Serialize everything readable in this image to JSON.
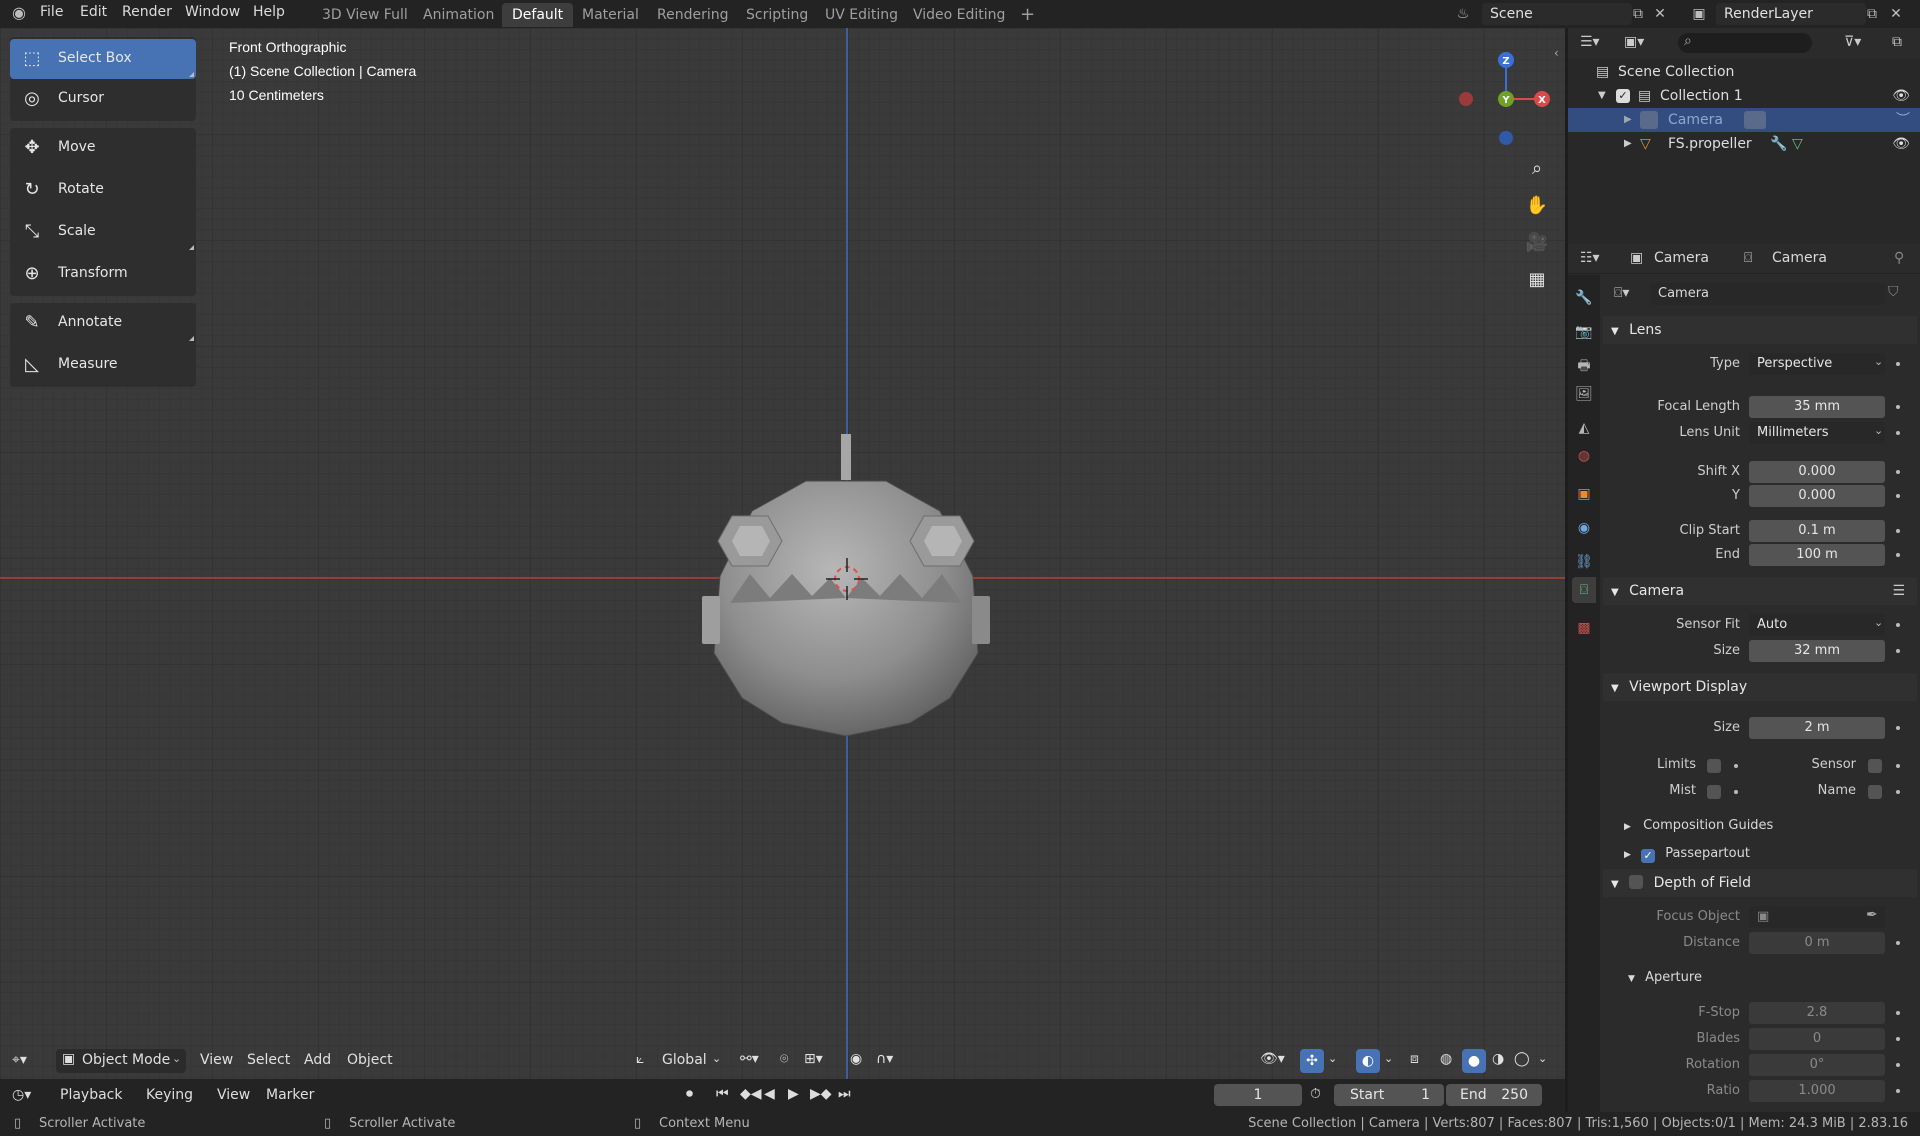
{
  "topbar": {
    "menus": [
      "File",
      "Edit",
      "Render",
      "Window",
      "Help"
    ],
    "workspaces": [
      "3D View Full",
      "Animation",
      "Default",
      "Material",
      "Rendering",
      "Scripting",
      "UV Editing",
      "Video Editing"
    ],
    "active_workspace": "Default",
    "add_tab": "+",
    "scene": "Scene",
    "render_layer": "RenderLayer"
  },
  "toolbar": {
    "tools": [
      {
        "label": "Select Box",
        "icon": "select-box-icon",
        "glyph": "⬚"
      },
      {
        "label": "Cursor",
        "icon": "cursor-icon",
        "glyph": "◎"
      },
      {
        "label": "Move",
        "icon": "move-icon",
        "glyph": "✥"
      },
      {
        "label": "Rotate",
        "icon": "rotate-icon",
        "glyph": "↻"
      },
      {
        "label": "Scale",
        "icon": "scale-icon",
        "glyph": "⤡"
      },
      {
        "label": "Transform",
        "icon": "transform-icon",
        "glyph": "⊕"
      },
      {
        "label": "Annotate",
        "icon": "annotate-icon",
        "glyph": "✎"
      },
      {
        "label": "Measure",
        "icon": "measure-icon",
        "glyph": "📐"
      }
    ],
    "active_tool": "Select Box"
  },
  "viewport": {
    "view_name": "Front Orthographic",
    "collection_info": "(1) Scene Collection | Camera",
    "scale_info": "10 Centimeters",
    "gizmo": {
      "z": "Z",
      "y": "Y",
      "x": "X"
    },
    "header": {
      "mode": "Object Mode",
      "menus": [
        "View",
        "Select",
        "Add",
        "Object"
      ],
      "orientation": "Global"
    }
  },
  "timeline": {
    "menus": [
      "Playback",
      "Keying",
      "View",
      "Marker"
    ],
    "current_frame": "1",
    "start_label": "Start",
    "start": "1",
    "end_label": "End",
    "end": "250"
  },
  "statusbar": {
    "left1": "Scroller Activate",
    "left2": "Scroller Activate",
    "left3": "Context Menu",
    "stats": "Scene Collection | Camera | Verts:807 | Faces:807 | Tris:1,560 | Objects:0/1 | Mem: 24.3 MiB | 2.83.16"
  },
  "outliner": {
    "root": "Scene Collection",
    "items": [
      {
        "label": "Collection 1",
        "type": "collection"
      },
      {
        "label": "Camera",
        "type": "camera",
        "selected": true
      },
      {
        "label": "FS.propeller",
        "type": "mesh"
      }
    ]
  },
  "properties": {
    "breadcrumb_object": "Camera",
    "breadcrumb_data": "Camera",
    "datablock": "Camera",
    "lens": {
      "title": "Lens",
      "type_label": "Type",
      "type_value": "Perspective",
      "focal_label": "Focal Length",
      "focal_value": "35 mm",
      "unit_label": "Lens Unit",
      "unit_value": "Millimeters",
      "shiftx_label": "Shift X",
      "shiftx_value": "0.000",
      "shifty_label": "Y",
      "shifty_value": "0.000",
      "clipstart_label": "Clip Start",
      "clipstart_value": "0.1 m",
      "clipend_label": "End",
      "clipend_value": "100 m"
    },
    "camera": {
      "title": "Camera",
      "fit_label": "Sensor Fit",
      "fit_value": "Auto",
      "size_label": "Size",
      "size_value": "32 mm"
    },
    "viewport_display": {
      "title": "Viewport Display",
      "size_label": "Size",
      "size_value": "2 m",
      "limits": "Limits",
      "sensor": "Sensor",
      "mist": "Mist",
      "name": "Name",
      "composition": "Composition Guides",
      "passepartout": "Passepartout"
    },
    "dof": {
      "title": "Depth of Field",
      "focus_label": "Focus Object",
      "distance_label": "Distance",
      "distance_value": "0 m",
      "aperture": "Aperture",
      "fstop_label": "F-Stop",
      "fstop_value": "2.8",
      "blades_label": "Blades",
      "blades_value": "0",
      "rotation_label": "Rotation",
      "rotation_value": "0°",
      "ratio_label": "Ratio",
      "ratio_value": "1.000"
    }
  }
}
